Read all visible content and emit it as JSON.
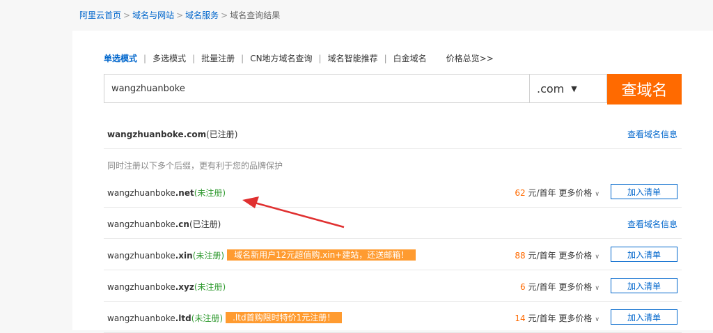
{
  "breadcrumb": {
    "items": [
      "阿里云首页",
      "域名与网站",
      "域名服务"
    ],
    "current": "域名查询结果",
    "sep": ">"
  },
  "modes": {
    "items": [
      "单选模式",
      "多选模式",
      "批量注册",
      "CN地方域名查询",
      "域名智能推荐",
      "白金域名"
    ],
    "price_link": "价格总览>>"
  },
  "search": {
    "value": "wangzhuanboke",
    "tld": ".com",
    "button": "查域名"
  },
  "results": {
    "main": {
      "sld": "wangzhuanboke",
      "tld": ".com",
      "status": "(已注册)",
      "link": "查看域名信息"
    },
    "note": "同时注册以下多个后缀，更有利于您的品牌保护",
    "rows": [
      {
        "sld": "wangzhuanboke",
        "tld": ".net",
        "status": "(未注册)",
        "promo": "",
        "price": "62",
        "unit": "元/首年",
        "more": "更多价格",
        "btn": "加入清单"
      },
      {
        "sld": "wangzhuanboke",
        "tld": ".cn",
        "status": "(已注册)",
        "link": "查看域名信息"
      },
      {
        "sld": "wangzhuanboke",
        "tld": ".xin",
        "status": "(未注册)",
        "promo": "域名新用户12元超值购.xin+建站，还送邮箱！",
        "price": "88",
        "unit": "元/首年",
        "more": "更多价格",
        "btn": "加入清单"
      },
      {
        "sld": "wangzhuanboke",
        "tld": ".xyz",
        "status": "(未注册)",
        "promo": "",
        "price": "6",
        "unit": "元/首年",
        "more": "更多价格",
        "btn": "加入清单"
      },
      {
        "sld": "wangzhuanboke",
        "tld": ".ltd",
        "status": "(未注册)",
        "promo": ".ltd首购限时特价1元注册！",
        "price": "14",
        "unit": "元/首年",
        "more": "更多价格",
        "btn": "加入清单"
      }
    ]
  },
  "colors": {
    "accent": "#ff6a00",
    "link": "#0066cc",
    "available": "#2f9a2f",
    "promo": "#ff9b30",
    "annotation_arrow": "#e03030"
  }
}
